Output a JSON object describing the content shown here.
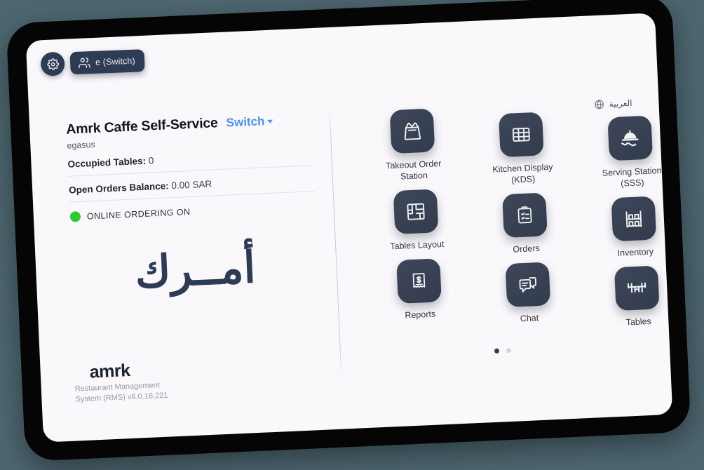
{
  "topbar": {
    "gear_icon": "gear-icon",
    "people_icon": "people-icon",
    "switch_user_label": "e (Switch)"
  },
  "left_panel": {
    "shop_name": "Amrk Caffe Self-Service",
    "switch_label": "Switch",
    "sub_label": "egasus",
    "stats": [
      {
        "key": "Occupied Tables:",
        "value": "0"
      },
      {
        "key": "Open Orders Balance:",
        "value": "0.00 SAR"
      }
    ],
    "status": {
      "text": "ONLINE ORDERING ON",
      "color": "#2ecb2e"
    },
    "brand_arabic": "أمــرك",
    "footer": {
      "logo": "amrk",
      "subtitle": "Restaurant Management System (RMS) v6.0.16.221"
    }
  },
  "right_panel": {
    "language": {
      "icon": "globe-icon",
      "label": "العربية"
    },
    "tiles": [
      {
        "label": "Takeout Order Station",
        "icon": "takeout-bag-icon"
      },
      {
        "label": "Kitchen Display (KDS)",
        "icon": "grid-screen-icon"
      },
      {
        "label": "Serving Station (SSS)",
        "icon": "serving-tray-icon"
      },
      {
        "label": "Tables Layout",
        "icon": "floor-plan-icon"
      },
      {
        "label": "Orders",
        "icon": "clipboard-check-icon"
      },
      {
        "label": "Inventory",
        "icon": "shelf-rack-icon"
      },
      {
        "label": "Reports",
        "icon": "receipt-dollar-icon"
      },
      {
        "label": "Chat",
        "icon": "chat-bubbles-icon"
      },
      {
        "label": "Tables",
        "icon": "table-chairs-icon"
      }
    ],
    "pagination": {
      "pages": 2,
      "active": 1
    }
  },
  "colors": {
    "background": "#4d6670",
    "device_frame": "#050505",
    "screen": "#faf8fb",
    "tile": "#3a4457",
    "accent_blue": "#4b93e8",
    "status_green": "#2ecb2e",
    "brand_navy": "#2d3b54"
  }
}
